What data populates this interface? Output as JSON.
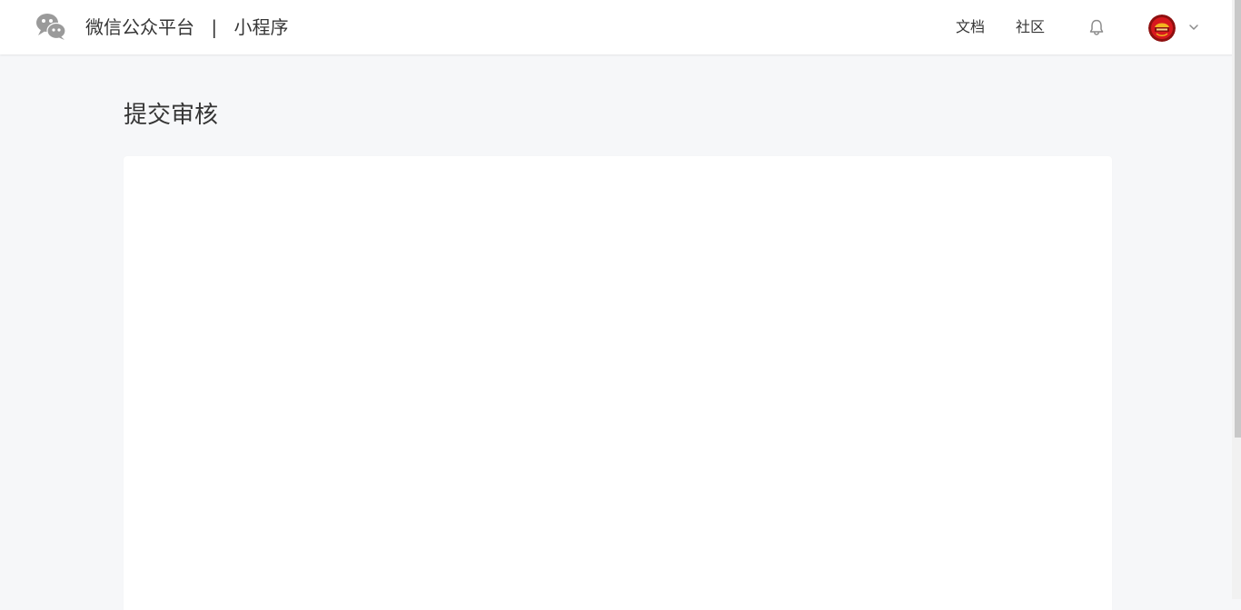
{
  "header": {
    "brand": "微信公众平台",
    "separator": "|",
    "product": "小程序",
    "nav": {
      "docs": "文档",
      "community": "社区"
    },
    "icons": {
      "logo": "wechat-logo-icon",
      "notifications": "bell-icon",
      "account_menu": "chevron-down-icon"
    },
    "avatar_colors": {
      "outer": "#8e1010",
      "inner": "#d8181e",
      "accent": "#f2b51f"
    }
  },
  "main": {
    "title": "提交审核"
  },
  "colors": {
    "page_background": "#f6f7f9",
    "header_background": "#ffffff",
    "text": "#353535",
    "card_background": "#ffffff"
  }
}
